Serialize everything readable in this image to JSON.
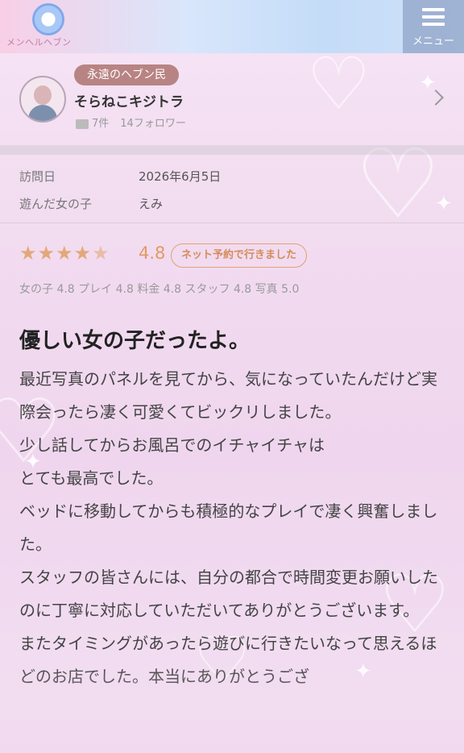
{
  "header": {
    "logo_text": "メンヘルヘブン",
    "menu_label": "メニュー"
  },
  "user": {
    "rank": "永遠のヘブン民",
    "name": "そらねこキジトラ",
    "posts": "7件",
    "followers": "14フォロワー"
  },
  "visit": {
    "date_label": "訪問日",
    "date_value": "2026年6月5日",
    "girl_label": "遊んだ女の子",
    "girl_value": "えみ"
  },
  "rating": {
    "stars_value": 4.5,
    "score": "4.8",
    "badge": "ネット予約で行きました",
    "subscores": "女の子 4.8  プレイ 4.8  料金 4.8  スタッフ 4.8  写真 5.0"
  },
  "review": {
    "title": "優しい女の子だったよ。",
    "paragraphs": [
      "最近写真のパネルを見てから、気になっていたんだけど実際会ったら凄く可愛くてビックリしました。",
      "少し話してからお風呂でのイチャイチャは",
      "とても最高でした。",
      "ベッドに移動してからも積極的なプレイで凄く興奮しました。",
      "スタッフの皆さんには、自分の都合で時間変更お願いしたのに丁寧に対応していただいてありがとうございます。",
      "またタイミングがあったら遊びに行きたいなって思えるほどのお店でした。本当にありがとうござ"
    ]
  },
  "icons": {
    "menu": "hamburger-icon",
    "chevron": "chevron-right-icon",
    "comment": "comment-icon",
    "star": "star-icon"
  },
  "colors": {
    "accent": "#e29a63",
    "badge_bg": "#b88483"
  }
}
